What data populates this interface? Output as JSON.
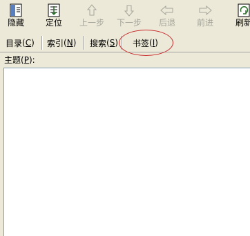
{
  "toolbar": {
    "buttons": [
      {
        "label": "隐藏",
        "icon": "hide-icon",
        "enabled": true
      },
      {
        "label": "定位",
        "icon": "locate-icon",
        "enabled": true
      },
      {
        "label": "上一步",
        "icon": "arrow-up-icon",
        "enabled": false
      },
      {
        "label": "下一步",
        "icon": "arrow-down-icon",
        "enabled": false
      },
      {
        "label": "后退",
        "icon": "arrow-left-icon",
        "enabled": false
      },
      {
        "label": "前进",
        "icon": "arrow-right-icon",
        "enabled": false
      },
      {
        "label": "刷新",
        "icon": "refresh-icon",
        "enabled": true
      }
    ]
  },
  "tabs": [
    {
      "label": "目录",
      "accel": "C"
    },
    {
      "label": "索引",
      "accel": "N"
    },
    {
      "label": "搜索",
      "accel": "S"
    },
    {
      "label": "书签",
      "accel": "I"
    }
  ],
  "active_tab": "书签",
  "topic": {
    "label": "主题",
    "accel": "P"
  },
  "colors": {
    "highlight": "#c8282a",
    "window": "#ece9d8",
    "disabled_text": "#a5a59a"
  }
}
